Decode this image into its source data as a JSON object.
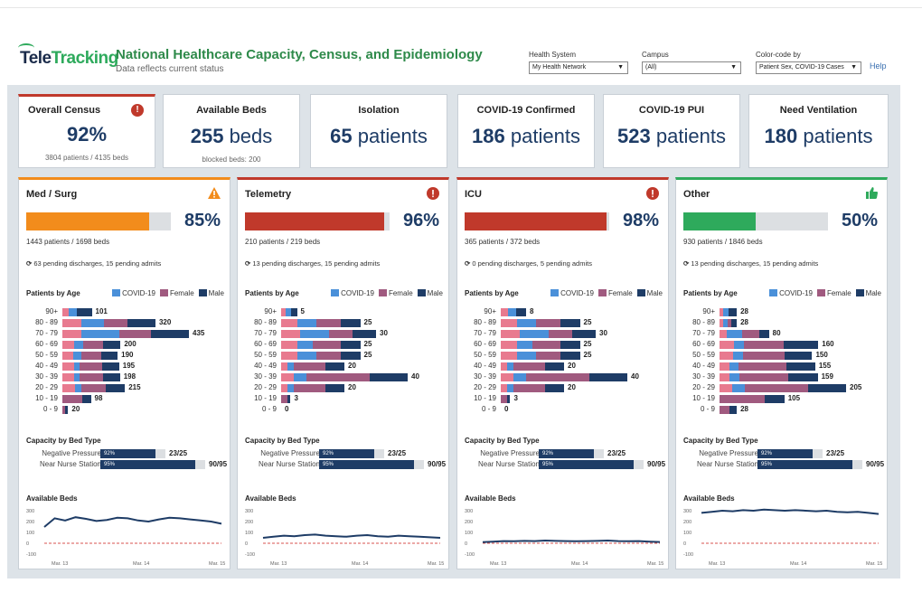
{
  "header": {
    "logo_part1": "Tele",
    "logo_part2": "Tracking",
    "title": "National Healthcare Capacity, Census, and Epidemiology",
    "subtitle": "Data reflects current status",
    "help": "Help",
    "filters": [
      {
        "label": "Health System",
        "value": "My Health Network"
      },
      {
        "label": "Campus",
        "value": "(All)"
      },
      {
        "label": "Color-code by",
        "value": "Patient Sex, COVID-19 Cases"
      }
    ]
  },
  "kpis": [
    {
      "title": "Overall Census",
      "value": "92%",
      "unit": "",
      "sub": "3804 patients / 4135 beds"
    },
    {
      "title": "Available Beds",
      "value": "255",
      "unit": "beds",
      "sub": "blocked beds: 200"
    },
    {
      "title": "Isolation",
      "value": "65",
      "unit": "patients",
      "sub": ""
    },
    {
      "title": "COVID-19 Confirmed",
      "value": "186",
      "unit": "patients",
      "sub": ""
    },
    {
      "title": "COVID-19 PUI",
      "value": "523",
      "unit": "patients",
      "sub": ""
    },
    {
      "title": "Need Ventilation",
      "value": "180",
      "unit": "patients",
      "sub": ""
    }
  ],
  "labels": {
    "patients_by_age": "Patients by Age",
    "legend_covid": "COVID-19",
    "legend_female": "Female",
    "legend_male": "Male",
    "capacity_by_bed_type": "Capacity by Bed Type",
    "available_beds": "Available Beds",
    "neg_pressure": "Negative Pressure",
    "near_nurse": "Near Nurse Station"
  },
  "age_groups": [
    "90+",
    "80 - 89",
    "70 - 79",
    "60 - 69",
    "50 - 59",
    "40 - 49",
    "30 - 39",
    "20 - 29",
    "10 - 19",
    "0 - 9"
  ],
  "colors": {
    "covid": "#4a90d9",
    "female": "#a05a7f",
    "male": "#1e3c66",
    "pink": "#e87a8f",
    "orange": "#f28c1c",
    "red": "#c0392b",
    "green": "#2eaa5c",
    "navy": "#1e3c66"
  },
  "spark_axis": {
    "y": [
      "300",
      "200",
      "100",
      "0",
      "-100"
    ],
    "x": [
      "Mar. 13",
      "Mar. 14",
      "Mar. 15"
    ]
  },
  "panels": [
    {
      "name": "Med / Surg",
      "status": "warning",
      "pct": "85%",
      "pct_value": 0.85,
      "bar_color": "#f28c1c",
      "border": "#f28c1c",
      "patients": "1443 patients / 1698 beds",
      "pending": "63 pending discharges, 15 pending admits",
      "ages": [
        {
          "covid": 0.3,
          "pink": 0.2,
          "female": 0,
          "male": 0.5,
          "total": 101
        },
        {
          "covid": 0.25,
          "pink": 0.2,
          "female": 0.25,
          "male": 0.3,
          "total": 320
        },
        {
          "covid": 0.3,
          "pink": 0.15,
          "female": 0.25,
          "male": 0.3,
          "total": 435
        },
        {
          "covid": 0.15,
          "pink": 0.2,
          "female": 0.35,
          "male": 0.3,
          "total": 200
        },
        {
          "covid": 0.15,
          "pink": 0.2,
          "female": 0.35,
          "male": 0.3,
          "total": 190
        },
        {
          "covid": 0.1,
          "pink": 0.2,
          "female": 0.4,
          "male": 0.3,
          "total": 195
        },
        {
          "covid": 0.1,
          "pink": 0.2,
          "female": 0.4,
          "male": 0.3,
          "total": 198
        },
        {
          "covid": 0.1,
          "pink": 0.2,
          "female": 0.4,
          "male": 0.3,
          "total": 215
        },
        {
          "covid": 0,
          "pink": 0,
          "female": 0.7,
          "male": 0.3,
          "total": 98
        },
        {
          "covid": 0,
          "pink": 0,
          "female": 0.5,
          "male": 0.5,
          "total": 20
        }
      ],
      "age_max": 435,
      "neg_pct_label": "92%",
      "neg_pct": 0.92,
      "neg_value": "23/25",
      "near_pct_label": "95%",
      "near_pct": 0.95,
      "near_value": "90/95",
      "spark": [
        150,
        230,
        210,
        240,
        225,
        205,
        215,
        235,
        230,
        210,
        200,
        220,
        235,
        230,
        220,
        210,
        200,
        180
      ]
    },
    {
      "name": "Telemetry",
      "status": "alert",
      "pct": "96%",
      "pct_value": 0.96,
      "bar_color": "#c0392b",
      "border": "#c0392b",
      "patients": "210 patients / 219 beds",
      "pending": "13 pending discharges, 15 pending admits",
      "ages": [
        {
          "covid": 0.3,
          "pink": 0.3,
          "female": 0,
          "male": 0.4,
          "total": 5
        },
        {
          "covid": 0.25,
          "pink": 0.2,
          "female": 0.3,
          "male": 0.25,
          "total": 25
        },
        {
          "covid": 0.3,
          "pink": 0.2,
          "female": 0.25,
          "male": 0.25,
          "total": 30
        },
        {
          "covid": 0.2,
          "pink": 0.2,
          "female": 0.35,
          "male": 0.25,
          "total": 25
        },
        {
          "covid": 0.25,
          "pink": 0.2,
          "female": 0.3,
          "male": 0.25,
          "total": 25
        },
        {
          "covid": 0.1,
          "pink": 0.1,
          "female": 0.5,
          "male": 0.3,
          "total": 20
        },
        {
          "covid": 0.1,
          "pink": 0.1,
          "female": 0.5,
          "male": 0.3,
          "total": 40
        },
        {
          "covid": 0.1,
          "pink": 0.1,
          "female": 0.5,
          "male": 0.3,
          "total": 20
        },
        {
          "covid": 0,
          "pink": 0,
          "female": 0.7,
          "male": 0.3,
          "total": 3
        },
        {
          "covid": 0,
          "pink": 0,
          "female": 0,
          "male": 0,
          "total": 0
        }
      ],
      "age_max": 40,
      "neg_pct_label": "92%",
      "neg_pct": 0.92,
      "neg_value": "23/25",
      "near_pct_label": "95%",
      "near_pct": 0.95,
      "near_value": "90/95",
      "spark": [
        50,
        60,
        70,
        65,
        75,
        80,
        70,
        65,
        60,
        70,
        75,
        65,
        60,
        70,
        65,
        60,
        55,
        50
      ]
    },
    {
      "name": "ICU",
      "status": "alert",
      "pct": "98%",
      "pct_value": 0.98,
      "bar_color": "#c0392b",
      "border": "#c0392b",
      "patients": "365 patients / 372 beds",
      "pending": "0 pending discharges, 5 pending admits",
      "ages": [
        {
          "covid": 0.3,
          "pink": 0.3,
          "female": 0,
          "male": 0.4,
          "total": 8
        },
        {
          "covid": 0.25,
          "pink": 0.2,
          "female": 0.3,
          "male": 0.25,
          "total": 25
        },
        {
          "covid": 0.3,
          "pink": 0.2,
          "female": 0.25,
          "male": 0.25,
          "total": 30
        },
        {
          "covid": 0.2,
          "pink": 0.2,
          "female": 0.35,
          "male": 0.25,
          "total": 25
        },
        {
          "covid": 0.25,
          "pink": 0.2,
          "female": 0.3,
          "male": 0.25,
          "total": 25
        },
        {
          "covid": 0.1,
          "pink": 0.1,
          "female": 0.5,
          "male": 0.3,
          "total": 20
        },
        {
          "covid": 0.1,
          "pink": 0.1,
          "female": 0.5,
          "male": 0.3,
          "total": 40
        },
        {
          "covid": 0.1,
          "pink": 0.1,
          "female": 0.5,
          "male": 0.3,
          "total": 20
        },
        {
          "covid": 0,
          "pink": 0,
          "female": 0.7,
          "male": 0.3,
          "total": 3
        },
        {
          "covid": 0,
          "pink": 0,
          "female": 0,
          "male": 0,
          "total": 0
        }
      ],
      "age_max": 40,
      "neg_pct_label": "92%",
      "neg_pct": 0.92,
      "neg_value": "23/25",
      "near_pct_label": "95%",
      "near_pct": 0.95,
      "near_value": "90/95",
      "spark": [
        10,
        15,
        20,
        18,
        22,
        20,
        25,
        22,
        20,
        18,
        20,
        22,
        25,
        20,
        18,
        20,
        15,
        12
      ]
    },
    {
      "name": "Other",
      "status": "ok",
      "pct": "50%",
      "pct_value": 0.5,
      "bar_color": "#2eaa5c",
      "border": "#2eaa5c",
      "patients": "930 patients / 1846 beds",
      "pending": "13 pending discharges, 15 pending admits",
      "ages": [
        {
          "covid": 0.3,
          "pink": 0.2,
          "female": 0,
          "male": 0.5,
          "total": 28
        },
        {
          "covid": 0.25,
          "pink": 0.2,
          "female": 0.25,
          "male": 0.3,
          "total": 28
        },
        {
          "covid": 0.3,
          "pink": 0.15,
          "female": 0.35,
          "male": 0.2,
          "total": 80
        },
        {
          "covid": 0.1,
          "pink": 0.15,
          "female": 0.4,
          "male": 0.35,
          "total": 160
        },
        {
          "covid": 0.1,
          "pink": 0.15,
          "female": 0.45,
          "male": 0.3,
          "total": 150
        },
        {
          "covid": 0.1,
          "pink": 0.1,
          "female": 0.5,
          "male": 0.3,
          "total": 155
        },
        {
          "covid": 0.1,
          "pink": 0.1,
          "female": 0.5,
          "male": 0.3,
          "total": 159
        },
        {
          "covid": 0.1,
          "pink": 0.1,
          "female": 0.5,
          "male": 0.3,
          "total": 205
        },
        {
          "covid": 0,
          "pink": 0,
          "female": 0.7,
          "male": 0.3,
          "total": 105
        },
        {
          "covid": 0,
          "pink": 0,
          "female": 0.6,
          "male": 0.4,
          "total": 28
        }
      ],
      "age_max": 205,
      "neg_pct_label": "92%",
      "neg_pct": 0.92,
      "neg_value": "23/25",
      "near_pct_label": "95%",
      "near_pct": 0.95,
      "near_value": "90/95",
      "spark": [
        280,
        290,
        300,
        295,
        305,
        300,
        310,
        305,
        300,
        305,
        300,
        295,
        300,
        290,
        285,
        290,
        280,
        270
      ]
    }
  ]
}
